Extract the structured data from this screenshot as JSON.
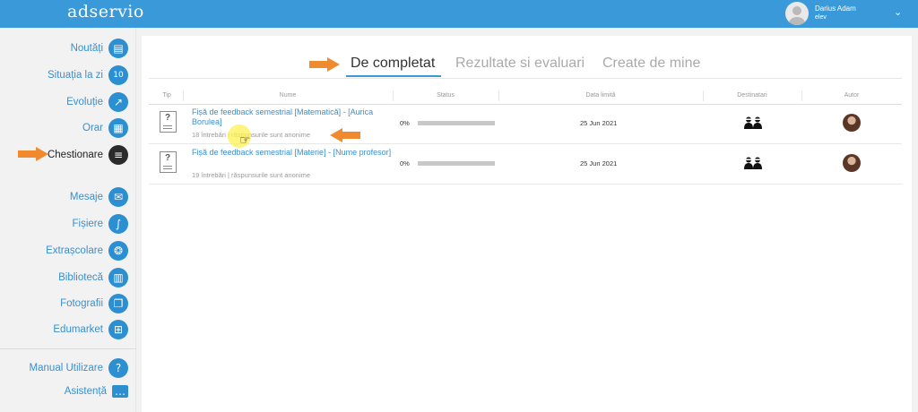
{
  "app": {
    "logo": "adservio"
  },
  "user": {
    "name": "Darius Adam",
    "role": "elev"
  },
  "sidebar": {
    "items": [
      {
        "label": "Noutăți",
        "icon": "news-icon",
        "glyph": "▤"
      },
      {
        "label": "Situația la zi",
        "icon": "grades-icon",
        "glyph": "⅒"
      },
      {
        "label": "Evoluție",
        "icon": "trend-icon",
        "glyph": "↗"
      },
      {
        "label": "Orar",
        "icon": "calendar-icon",
        "glyph": "▦"
      },
      {
        "label": "Chestionare",
        "icon": "survey-icon",
        "glyph": "✓",
        "active": true
      },
      {
        "label": "Mesaje",
        "icon": "mail-icon",
        "glyph": "✉"
      },
      {
        "label": "Fișiere",
        "icon": "paperclip-icon",
        "glyph": "⌇"
      },
      {
        "label": "Extrașcolare",
        "icon": "activities-icon",
        "glyph": "✲"
      },
      {
        "label": "Bibliotecă",
        "icon": "book-icon",
        "glyph": "▥"
      },
      {
        "label": "Fotografii",
        "icon": "photos-icon",
        "glyph": "❐"
      },
      {
        "label": "Edumarket",
        "icon": "cart-icon",
        "glyph": "⊞"
      },
      {
        "label": "Manual Utilizare",
        "icon": "help-icon",
        "glyph": "?"
      },
      {
        "label": "Asistență",
        "icon": "chat-icon",
        "glyph": "▬"
      }
    ]
  },
  "tabs": [
    {
      "label": "De completat",
      "active": true
    },
    {
      "label": "Rezultate si evaluari",
      "active": false
    },
    {
      "label": "Create de mine",
      "active": false
    }
  ],
  "table": {
    "columns": [
      "Tip",
      "Nume",
      "Status",
      "Data limită",
      "Destinatari",
      "Autor"
    ],
    "rows": [
      {
        "title": "Fișă de feedback semestrial [Matematică] - [Aurica Borulea]",
        "subtitle": "18 întrebări | răspunsurile sunt anonime",
        "status": "0%",
        "progress": 0,
        "deadline": "25 Jun 2021"
      },
      {
        "title": "Fișă de feedback semestrial [Materie] - [Nume profesor]",
        "subtitle": "19 întrebări | răspunsurile sunt anonime",
        "status": "0%",
        "progress": 0,
        "deadline": "25 Jun 2021"
      }
    ]
  },
  "colors": {
    "brand": "#3a9ad9",
    "annotation_arrow": "#f08a2e",
    "active_icon": "#2b2b2b"
  }
}
